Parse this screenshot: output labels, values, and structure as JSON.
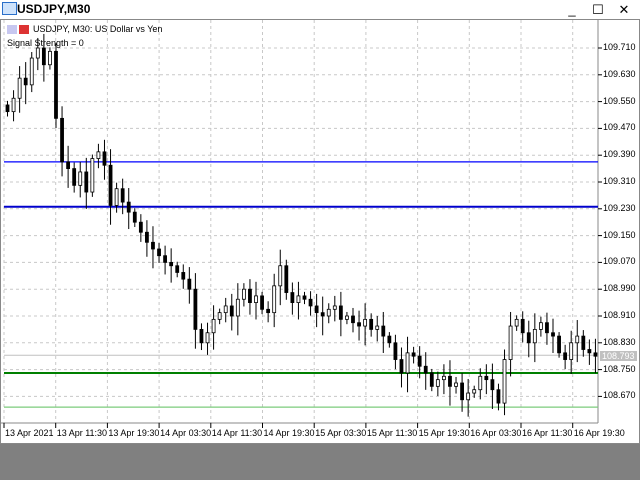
{
  "window": {
    "title": "USDJPY,M30",
    "minimize": "_",
    "maximize": "☐",
    "close": "✕"
  },
  "chart": {
    "header": "USDJPY, M30:  US Dollar vs Yen",
    "indicator": "Signal Strength = 0",
    "current_price": "108.793",
    "price_labels": [
      "109.710",
      "109.630",
      "109.550",
      "109.470",
      "109.390",
      "109.310",
      "109.230",
      "109.150",
      "109.070",
      "108.990",
      "108.910",
      "108.830",
      "108.750",
      "108.670"
    ],
    "time_labels": [
      "13 Apr 2021",
      "13 Apr 11:30",
      "13 Apr 19:30",
      "14 Apr 03:30",
      "14 Apr 11:30",
      "14 Apr 19:30",
      "15 Apr 03:30",
      "15 Apr 11:30",
      "15 Apr 19:30",
      "16 Apr 03:30",
      "16 Apr 11:30",
      "16 Apr 19:30"
    ],
    "levels": [
      {
        "price": 109.37,
        "color": "#0000ff"
      },
      {
        "price": 109.236,
        "color": "#0000cc"
      },
      {
        "price": 108.74,
        "color": "#008000"
      },
      {
        "price": 108.638,
        "color": "#7ccc7c"
      }
    ]
  },
  "chart_data": {
    "type": "candlestick",
    "symbol": "USDJPY",
    "timeframe": "M30",
    "ylim": [
      108.63,
      109.79
    ],
    "closes": [
      109.52,
      109.56,
      109.62,
      109.6,
      109.68,
      109.71,
      109.66,
      109.7,
      109.5,
      109.37,
      109.35,
      109.3,
      109.34,
      109.28,
      109.38,
      109.4,
      109.36,
      109.24,
      109.29,
      109.25,
      109.22,
      109.19,
      109.16,
      109.13,
      109.11,
      109.09,
      109.07,
      109.06,
      109.04,
      109.02,
      108.99,
      108.87,
      108.83,
      108.86,
      108.9,
      108.92,
      108.94,
      108.91,
      108.96,
      108.99,
      108.95,
      108.97,
      108.93,
      108.92,
      109.0,
      109.06,
      108.98,
      108.95,
      108.97,
      108.96,
      108.94,
      108.92,
      108.91,
      108.93,
      108.94,
      108.9,
      108.91,
      108.89,
      108.88,
      108.9,
      108.87,
      108.88,
      108.85,
      108.83,
      108.78,
      108.74,
      108.8,
      108.79,
      108.76,
      108.74,
      108.7,
      108.72,
      108.73,
      108.7,
      108.71,
      108.66,
      108.68,
      108.69,
      108.73,
      108.72,
      108.69,
      108.65,
      108.78,
      108.88,
      108.9,
      108.86,
      108.83,
      108.87,
      108.89,
      108.86,
      108.85,
      108.8,
      108.78,
      108.83,
      108.85,
      108.81,
      108.8,
      108.79
    ]
  }
}
